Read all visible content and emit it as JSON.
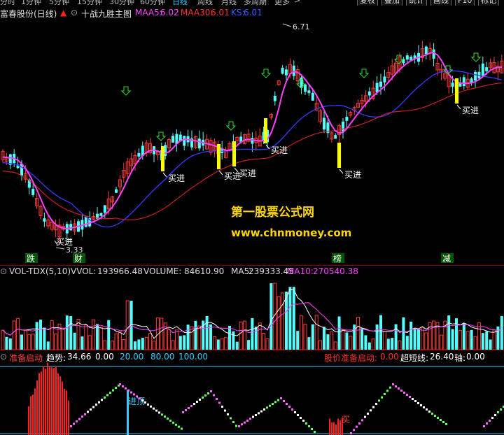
{
  "toolbar": {
    "periods": [
      "分时",
      "1分钟",
      "5分钟",
      "15分钟",
      "30分钟",
      "60分钟",
      "日线",
      "周线",
      "月线",
      "多周期",
      "更多"
    ],
    "active_period": "日线",
    "buttons": [
      "复权",
      "叠加",
      "统计",
      "画线",
      "F10",
      "标记"
    ]
  },
  "main_chart": {
    "stock_name": "富春股份(日线)",
    "indicator_name": "十战九胜主图",
    "maa5_label": "MAA5:",
    "maa5_value": "6.02",
    "maa30_label": "MAA30:",
    "maa30_value": "6.01",
    "ks_label": "KS:",
    "ks_value": "6.01",
    "high_label": "6.71",
    "low_label": "3.33",
    "buy_signal_text": "买进",
    "bottom_tags": [
      "跌",
      "财",
      "榜",
      "减"
    ],
    "colors": {
      "up": "#ff3b3b",
      "down": "#54ffff",
      "maa5": "#ff40ff",
      "maa30": "#cc1f1f",
      "ks": "#3a3aff",
      "buy_bar": "#ffff00",
      "arrow": "#33dd33"
    }
  },
  "watermark": {
    "line1": "第一股票公式网",
    "line2": "www.chnmoney.com"
  },
  "volume_panel": {
    "name": "VOL-TDX(5,10)",
    "vvol_label": "VVOL:",
    "vvol_value": "193966.48",
    "volume_label": "VOLUME:",
    "volume_value": "84610.90",
    "ma5_label": "MA5:",
    "ma5_value": "239333.45",
    "ma10_label": "MA10:",
    "ma10_value": "270540.38"
  },
  "indicator_panel": {
    "name": "准备启动",
    "trend_label": "趋势:",
    "trend_value": "34.66",
    "levels": [
      "0.00",
      "20.00",
      "80.00",
      "100.00"
    ],
    "ready_label": "股价准备启动:",
    "ready_value": "0.00",
    "ultra_label": "超短线:",
    "ultra_value": "26.40",
    "axis_label": "轴:",
    "axis_value": "0.00",
    "enter_text": "进顶",
    "buy_text": "买"
  }
}
